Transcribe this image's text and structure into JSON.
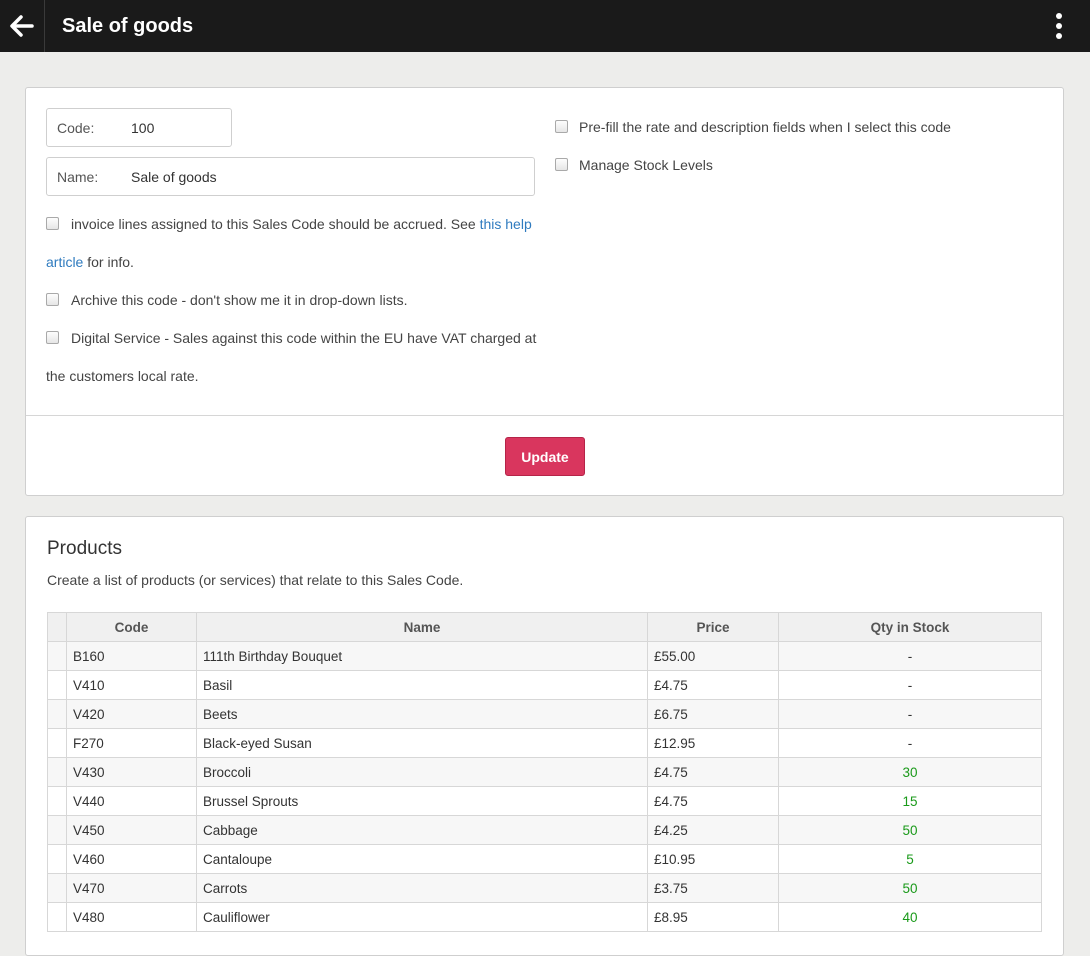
{
  "header": {
    "title": "Sale of goods",
    "back_icon": "arrow-left-icon",
    "menu_icon": "more-vertical-icon"
  },
  "form": {
    "code_label": "Code:",
    "code_value": "100",
    "name_label": "Name:",
    "name_value": "Sale of goods",
    "accrued_text": "invoice lines assigned to this Sales Code should be accrued. See ",
    "accrued_link_1": "this help",
    "accrued_link_2": "article",
    "accrued_text_2": " for info.",
    "archive_label": "Archive this code - don't show me it in drop-down lists.",
    "digital_label_1": "Digital Service - Sales against this code within the EU have VAT charged at",
    "digital_label_2": "the customers local rate.",
    "prefill_label": "Pre-fill the rate and description fields when I select this code",
    "stock_label": "Manage Stock Levels",
    "update_label": "Update"
  },
  "products": {
    "title": "Products",
    "description": "Create a list of products (or services) that relate to this Sales Code.",
    "columns": [
      "Code",
      "Name",
      "Price",
      "Qty in Stock"
    ],
    "rows": [
      {
        "code": "B160",
        "name": "111th Birthday Bouquet",
        "price": "£55.00",
        "qty": "-"
      },
      {
        "code": "V410",
        "name": "Basil",
        "price": "£4.75",
        "qty": "-"
      },
      {
        "code": "V420",
        "name": "Beets",
        "price": "£6.75",
        "qty": "-"
      },
      {
        "code": "F270",
        "name": "Black-eyed Susan",
        "price": "£12.95",
        "qty": "-"
      },
      {
        "code": "V430",
        "name": "Broccoli",
        "price": "£4.75",
        "qty": "30"
      },
      {
        "code": "V440",
        "name": "Brussel Sprouts",
        "price": "£4.75",
        "qty": "15"
      },
      {
        "code": "V450",
        "name": "Cabbage",
        "price": "£4.25",
        "qty": "50"
      },
      {
        "code": "V460",
        "name": "Cantaloupe",
        "price": "£10.95",
        "qty": "5"
      },
      {
        "code": "V470",
        "name": "Carrots",
        "price": "£3.75",
        "qty": "50"
      },
      {
        "code": "V480",
        "name": "Cauliflower",
        "price": "£8.95",
        "qty": "40"
      }
    ]
  },
  "colors": {
    "topbar": "#1a1a1a",
    "update_button": "#d9365e",
    "link": "#2f7bbf",
    "in_stock": "#1a9a1a"
  }
}
